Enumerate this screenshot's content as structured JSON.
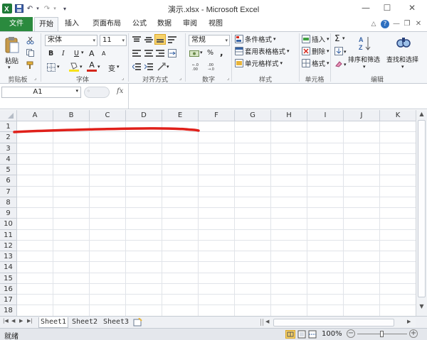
{
  "window": {
    "title": "演示.xlsx - Microsoft Excel",
    "minimize": "—",
    "maximize": "☐",
    "close": "✕"
  },
  "quick_access": {
    "save": "💾",
    "undo": "↶",
    "redo": "↷",
    "customize": "▾"
  },
  "tabs": [
    {
      "label": "文件"
    },
    {
      "label": "开始"
    },
    {
      "label": "插入"
    },
    {
      "label": "页面布局"
    },
    {
      "label": "公式"
    },
    {
      "label": "数据"
    },
    {
      "label": "审阅"
    },
    {
      "label": "视图"
    }
  ],
  "help": {
    "minimize_ribbon": "△",
    "help": "?",
    "min": "—",
    "restore": "❐",
    "close": "✕"
  },
  "ribbon": {
    "clipboard": {
      "paste": "粘贴",
      "label": "剪贴板"
    },
    "font": {
      "name": "宋体",
      "size": "11",
      "bold": "B",
      "italic": "I",
      "underline": "U",
      "grow": "A",
      "shrink": "A",
      "label": "字体",
      "font_color_glyph": "A",
      "phonetic": "变"
    },
    "alignment": {
      "label": "对齐方式"
    },
    "number": {
      "format": "常规",
      "percent": "%",
      "comma": ",",
      "label": "数字"
    },
    "styles": {
      "conditional": "条件格式",
      "table": "套用表格格式",
      "cell": "单元格样式",
      "label": "样式"
    },
    "cells": {
      "insert": "插入",
      "delete": "删除",
      "format": "格式",
      "label": "单元格"
    },
    "editing": {
      "sigma": "Σ",
      "sort": "排序和筛选",
      "find": "查找和选择",
      "label": "编辑"
    }
  },
  "formula_bar": {
    "name_box": "A1",
    "fx": "fx",
    "formula": ""
  },
  "columns": [
    "A",
    "B",
    "C",
    "D",
    "E",
    "F",
    "G",
    "H",
    "I",
    "J",
    "K"
  ],
  "rows": [
    "1",
    "2",
    "3",
    "4",
    "5",
    "6",
    "7",
    "8",
    "9",
    "10",
    "11",
    "12",
    "13",
    "14",
    "15",
    "16",
    "17",
    "18"
  ],
  "sheets": [
    "Sheet1",
    "Sheet2",
    "Sheet3"
  ],
  "status": {
    "ready": "就绪",
    "zoom": "100%",
    "minus": "−",
    "plus": "+"
  },
  "colors": {
    "file_tab": "#2a8a3e",
    "red_mark": "#e0201a",
    "fill_yellow": "#f7e21b",
    "font_red": "#d4261b"
  }
}
